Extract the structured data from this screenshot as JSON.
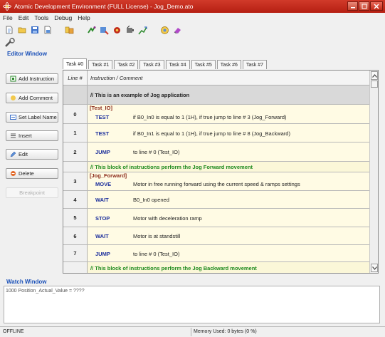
{
  "window": {
    "title": "Atomic Development Environment (FULL License) - Jog_Demo.ato"
  },
  "menu": [
    {
      "label": "File"
    },
    {
      "label": "Edit"
    },
    {
      "label": "Tools"
    },
    {
      "label": "Debug"
    },
    {
      "label": "Help"
    }
  ],
  "editor": {
    "section_label": "Editor Window",
    "tabs": [
      "Task #0",
      "Task #1",
      "Task #2",
      "Task #3",
      "Task #4",
      "Task #5",
      "Task #6",
      "Task #7"
    ],
    "active_tab": "Task #0",
    "buttons": {
      "add_instruction": "Add Instruction",
      "add_comment": "Add Comment",
      "set_label_name": "Set Label Name",
      "insert": "Insert",
      "edit": "Edit",
      "delete": "Delete",
      "breakpoint": "Breakpoint"
    },
    "columns": {
      "line": "Line #",
      "instruction": "Instruction / Comment"
    },
    "rows": [
      {
        "type": "comment",
        "num": "",
        "text": "// This is an example of Jog application"
      },
      {
        "type": "instruction",
        "num": "0",
        "label": "[Test_IO]",
        "keyword": "TEST",
        "desc": "if B0_In0 is equal to 1 (1H), if true jump to line # 3 (Jog_Forward)"
      },
      {
        "type": "instruction",
        "num": "1",
        "label": "",
        "keyword": "TEST",
        "desc": "if B0_In1 is equal to 1 (1H), if true jump to line # 8 (Jog_Backward)"
      },
      {
        "type": "instruction",
        "num": "2",
        "label": "",
        "keyword": "JUMP",
        "desc": "to line # 0 (Test_IO)"
      },
      {
        "type": "comment",
        "num": "",
        "text": "// This block of instructions perform the Jog Forward movement"
      },
      {
        "type": "instruction",
        "num": "3",
        "label": "[Jog_Forward]",
        "keyword": "MOVE",
        "desc": "Motor in free running forward using the current speed & ramps settings"
      },
      {
        "type": "instruction",
        "num": "4",
        "label": "",
        "keyword": "WAIT",
        "desc": "B0_In0 opened"
      },
      {
        "type": "instruction",
        "num": "5",
        "label": "",
        "keyword": "STOP",
        "desc": "Motor with deceleration ramp"
      },
      {
        "type": "instruction",
        "num": "6",
        "label": "",
        "keyword": "WAIT",
        "desc": "Motor is at standstill"
      },
      {
        "type": "instruction",
        "num": "7",
        "label": "",
        "keyword": "JUMP",
        "desc": "to line # 0 (Test_IO)"
      },
      {
        "type": "comment",
        "num": "",
        "text": "// This block of instructions perform the Jog Backward movement"
      }
    ]
  },
  "watch": {
    "section_label": "Watch Window",
    "content": "1000 Position_Actual_Value = ????"
  },
  "status": {
    "left": "OFFLINE",
    "memory": "Memory Used: 0 bytes (0 %)"
  },
  "colors": {
    "title_bar": "#c22a18",
    "keyword": "#1c2f9c",
    "label": "#8b2a1a",
    "comment_green": "#1e8a1e",
    "section_label": "#1a50b8"
  }
}
